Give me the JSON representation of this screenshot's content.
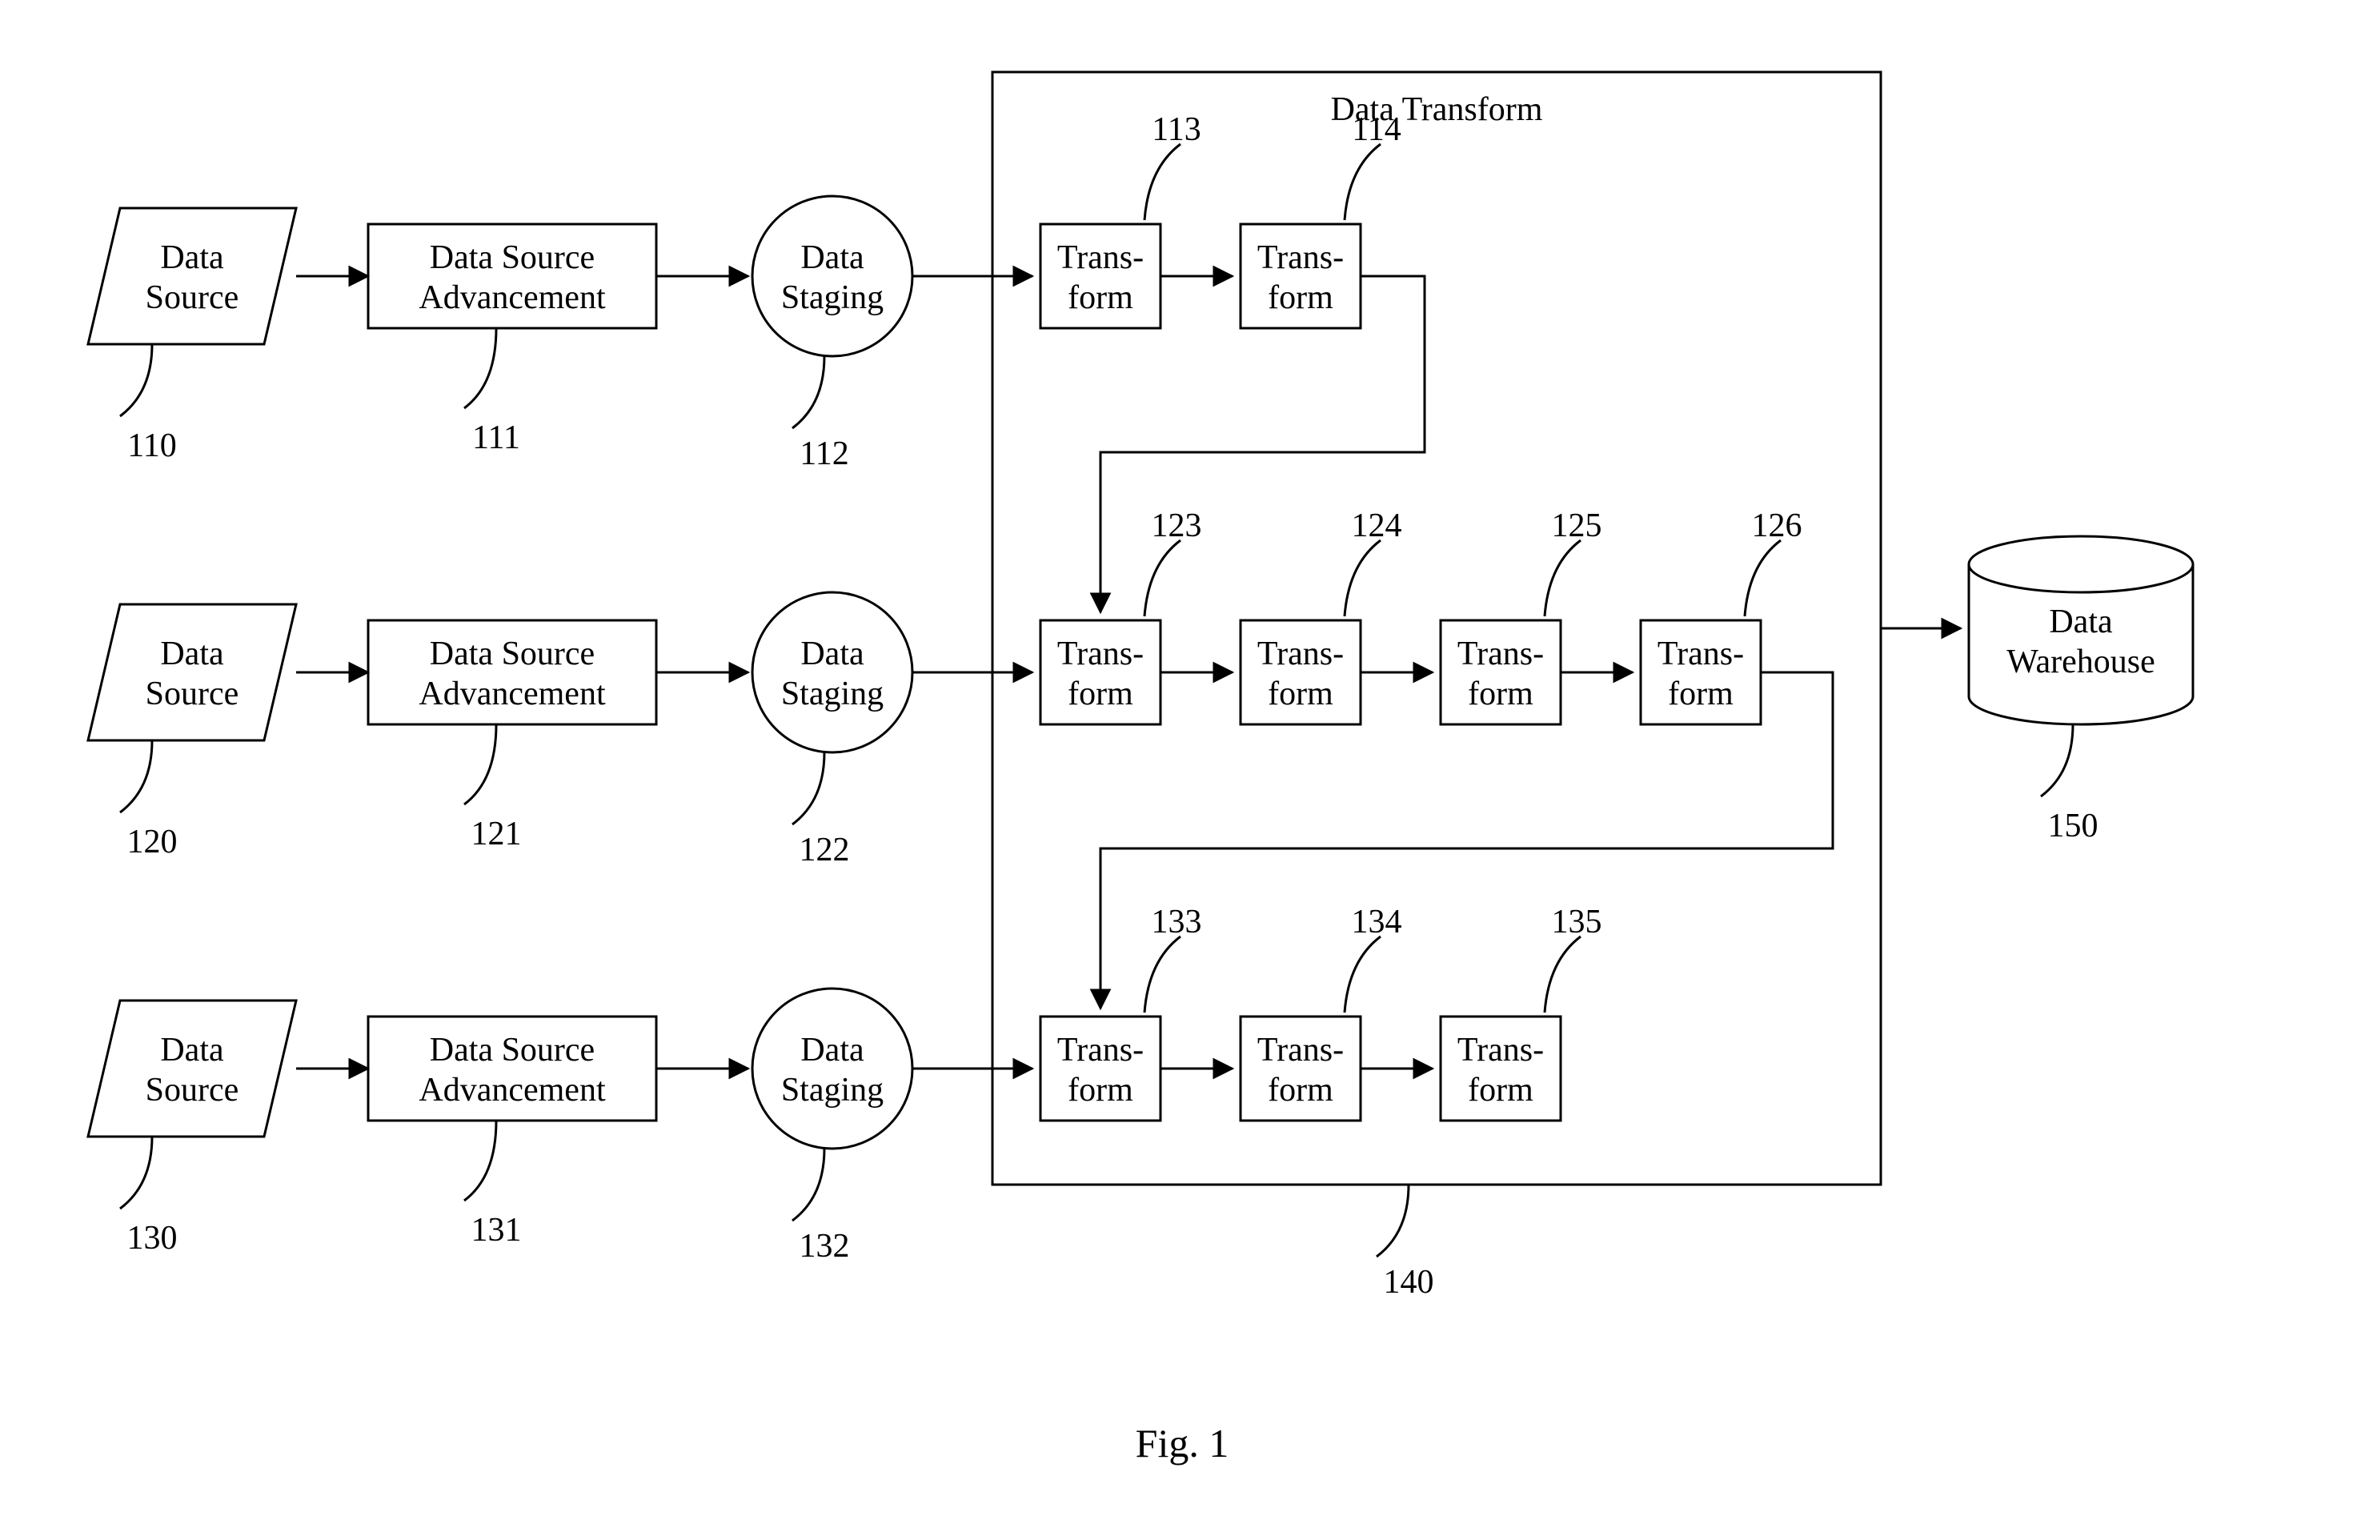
{
  "figure_caption": "Fig. 1",
  "transform_container_title": "Data Transform",
  "data_warehouse": {
    "label_line1": "Data",
    "label_line2": "Warehouse",
    "ref": "150"
  },
  "transform_container_ref": "140",
  "rows": [
    {
      "source": {
        "label_line1": "Data",
        "label_line2": "Source",
        "ref": "110"
      },
      "advance": {
        "label_line1": "Data Source",
        "label_line2": "Advancement",
        "ref": "111"
      },
      "staging": {
        "label_line1": "Data",
        "label_line2": "Staging",
        "ref": "112"
      },
      "transforms": [
        {
          "label_line1": "Trans-",
          "label_line2": "form",
          "ref": "113"
        },
        {
          "label_line1": "Trans-",
          "label_line2": "form",
          "ref": "114"
        }
      ]
    },
    {
      "source": {
        "label_line1": "Data",
        "label_line2": "Source",
        "ref": "120"
      },
      "advance": {
        "label_line1": "Data Source",
        "label_line2": "Advancement",
        "ref": "121"
      },
      "staging": {
        "label_line1": "Data",
        "label_line2": "Staging",
        "ref": "122"
      },
      "transforms": [
        {
          "label_line1": "Trans-",
          "label_line2": "form",
          "ref": "123"
        },
        {
          "label_line1": "Trans-",
          "label_line2": "form",
          "ref": "124"
        },
        {
          "label_line1": "Trans-",
          "label_line2": "form",
          "ref": "125"
        },
        {
          "label_line1": "Trans-",
          "label_line2": "form",
          "ref": "126"
        }
      ]
    },
    {
      "source": {
        "label_line1": "Data",
        "label_line2": "Source",
        "ref": "130"
      },
      "advance": {
        "label_line1": "Data Source",
        "label_line2": "Advancement",
        "ref": "131"
      },
      "staging": {
        "label_line1": "Data",
        "label_line2": "Staging",
        "ref": "132"
      },
      "transforms": [
        {
          "label_line1": "Trans-",
          "label_line2": "form",
          "ref": "133"
        },
        {
          "label_line1": "Trans-",
          "label_line2": "form",
          "ref": "134"
        },
        {
          "label_line1": "Trans-",
          "label_line2": "form",
          "ref": "135"
        }
      ]
    }
  ]
}
